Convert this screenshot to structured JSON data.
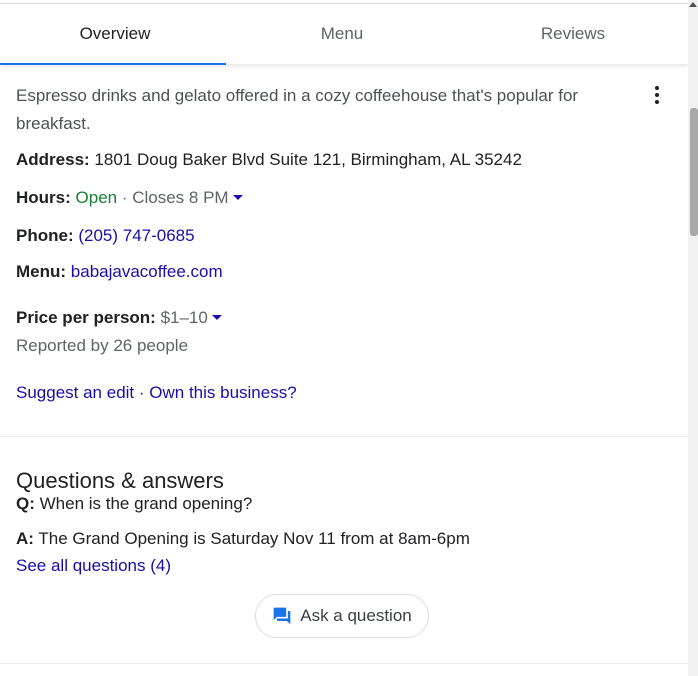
{
  "tabs": [
    {
      "label": "Overview",
      "active": true
    },
    {
      "label": "Menu",
      "active": false
    },
    {
      "label": "Reviews",
      "active": false
    }
  ],
  "description": "Espresso drinks and gelato offered in a cozy coffeehouse that's popular for breakfast.",
  "address": {
    "label": "Address:",
    "value": "1801 Doug Baker Blvd Suite 121, Birmingham, AL 35242"
  },
  "hours": {
    "label": "Hours:",
    "status": "Open",
    "separator": " · ",
    "closes": "Closes 8 PM"
  },
  "phone": {
    "label": "Phone:",
    "value": "(205) 747-0685"
  },
  "menu": {
    "label": "Menu:",
    "value": "babajavacoffee.com"
  },
  "price": {
    "label": "Price per person:",
    "value": "$1–10",
    "reported": "Reported by 26 people"
  },
  "edit_links": {
    "suggest": "Suggest an edit",
    "separator": " · ",
    "own": "Own this business?"
  },
  "qa": {
    "title": "Questions & answers",
    "q_prefix": "Q:",
    "question": "When is the grand opening?",
    "a_prefix": "A:",
    "answer": "The Grand Opening is Saturday Nov 11 from at 8am-6pm",
    "see_all": "See all questions (4)",
    "ask_button": "Ask a question"
  },
  "colors": {
    "link": "#1a0dab",
    "open": "#188038",
    "accent": "#1a73e8"
  }
}
